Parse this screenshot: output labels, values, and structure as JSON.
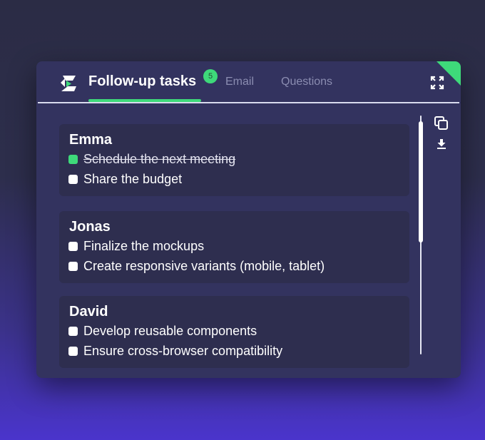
{
  "tabs": {
    "active": "Follow-up tasks",
    "badge_count": "5",
    "email": "Email",
    "questions": "Questions"
  },
  "icons": {
    "logo": "brand-logo-icon",
    "expand": "expand-icon",
    "copy": "copy-icon",
    "download": "download-icon"
  },
  "colors": {
    "accent": "#3ed97a",
    "panel": "#33335f",
    "card": "#2e2e4f"
  },
  "people": [
    {
      "name": "Emma",
      "tasks": [
        {
          "label": "Schedule the next meeting",
          "done": true
        },
        {
          "label": "Share the budget",
          "done": false
        }
      ]
    },
    {
      "name": "Jonas",
      "tasks": [
        {
          "label": "Finalize the mockups",
          "done": false
        },
        {
          "label": "Create responsive variants (mobile, tablet)",
          "done": false
        }
      ]
    },
    {
      "name": "David",
      "tasks": [
        {
          "label": "Develop reusable components",
          "done": false
        },
        {
          "label": "Ensure cross-browser compatibility",
          "done": false
        }
      ]
    }
  ]
}
